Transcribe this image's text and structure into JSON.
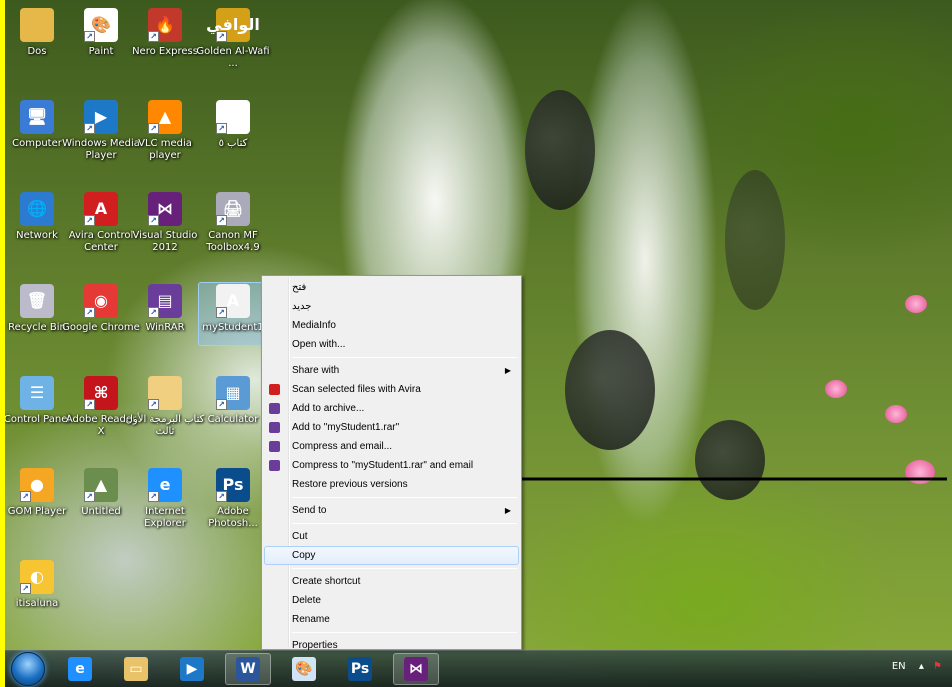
{
  "desktop_icons": [
    {
      "label": "Dos",
      "icon": "folder-user-icon",
      "color": "#e6b84a",
      "glyph": ""
    },
    {
      "label": "Paint",
      "icon": "paint-icon",
      "color": "#ffffff",
      "glyph": "🎨"
    },
    {
      "label": "Nero Express",
      "icon": "nero-icon",
      "color": "#c0392b",
      "glyph": "🔥"
    },
    {
      "label": "Golden Al-Wafi ...",
      "icon": "golden-alwafi-icon",
      "color": "#d4a017",
      "glyph": "الوافي"
    },
    {
      "label": "Computer",
      "icon": "computer-icon",
      "color": "#3a7bd5",
      "glyph": "🖥"
    },
    {
      "label": "Windows Media Player",
      "icon": "media-player-icon",
      "color": "#1e78c8",
      "glyph": "▶"
    },
    {
      "label": "VLC media player",
      "icon": "vlc-icon",
      "color": "#ff8800",
      "glyph": "▲"
    },
    {
      "label": "كتاب ٥",
      "icon": "document-icon",
      "color": "#ffffff",
      "glyph": "W"
    },
    {
      "label": "Network",
      "icon": "network-icon",
      "color": "#2d7bd1",
      "glyph": "🌐"
    },
    {
      "label": "Avira Control Center",
      "icon": "avira-icon",
      "color": "#d11f1f",
      "glyph": "A"
    },
    {
      "label": "Visual Studio 2012",
      "icon": "visual-studio-icon",
      "color": "#68217a",
      "glyph": "⋈"
    },
    {
      "label": "Canon MF Toolbox4.9",
      "icon": "canon-icon",
      "color": "#aab",
      "glyph": "🖨"
    },
    {
      "label": "Recycle Bin",
      "icon": "recycle-bin-icon",
      "color": "#bbc",
      "glyph": "🗑"
    },
    {
      "label": "Google Chrome",
      "icon": "chrome-icon",
      "color": "#e53935",
      "glyph": "◉"
    },
    {
      "label": "WinRAR",
      "icon": "winrar-icon",
      "color": "#6a3d9a",
      "glyph": "▤"
    },
    {
      "label": "myStudent1",
      "icon": "access-file-icon",
      "color": "#f2f2f2",
      "glyph": "A"
    },
    {
      "label": "Control Panel",
      "icon": "control-panel-icon",
      "color": "#6fb3e6",
      "glyph": "☰"
    },
    {
      "label": "Adobe Reader X",
      "icon": "adobe-reader-icon",
      "color": "#c4151c",
      "glyph": "⌘"
    },
    {
      "label": "كتاب البرمجة الأول ثالث",
      "icon": "folder-icon",
      "color": "#f0d080",
      "glyph": ""
    },
    {
      "label": "Calculator",
      "icon": "calculator-icon",
      "color": "#5a9bd5",
      "glyph": "▦"
    },
    {
      "label": "GOM Player",
      "icon": "gom-player-icon",
      "color": "#f5a623",
      "glyph": "●"
    },
    {
      "label": "Untitled",
      "icon": "image-file-icon",
      "color": "#6b8e4e",
      "glyph": "▲"
    },
    {
      "label": "Internet Explorer",
      "icon": "internet-explorer-icon",
      "color": "#1e90ff",
      "glyph": "e"
    },
    {
      "label": "Adobe Photosh...",
      "icon": "photoshop-icon",
      "color": "#0a4c8c",
      "glyph": "Ps"
    },
    {
      "label": "itisaluna",
      "icon": "itisaluna-icon",
      "color": "#f7c531",
      "glyph": "◐"
    }
  ],
  "context_menu": {
    "groups": [
      [
        {
          "label": "فتح",
          "icon": "",
          "rtl": true
        },
        {
          "label": "جديد",
          "icon": "",
          "rtl": true
        },
        {
          "label": "MediaInfo",
          "icon": ""
        },
        {
          "label": "Open with...",
          "icon": ""
        }
      ],
      [
        {
          "label": "Share with",
          "icon": "",
          "submenu": true
        },
        {
          "label": "Scan selected files with Avira",
          "icon": "avira-icon",
          "icon_color": "#d11f1f"
        },
        {
          "label": "Add to archive...",
          "icon": "winrar-icon",
          "icon_color": "#6a3d9a"
        },
        {
          "label": "Add to \"myStudent1.rar\"",
          "icon": "winrar-icon",
          "icon_color": "#6a3d9a"
        },
        {
          "label": "Compress and email...",
          "icon": "winrar-icon",
          "icon_color": "#6a3d9a"
        },
        {
          "label": "Compress to \"myStudent1.rar\" and email",
          "icon": "winrar-icon",
          "icon_color": "#6a3d9a"
        },
        {
          "label": "Restore previous versions",
          "icon": ""
        }
      ],
      [
        {
          "label": "Send to",
          "icon": "",
          "submenu": true
        }
      ],
      [
        {
          "label": "Cut",
          "icon": ""
        },
        {
          "label": "Copy",
          "icon": "",
          "highlighted": true
        }
      ],
      [
        {
          "label": "Create shortcut",
          "icon": ""
        },
        {
          "label": "Delete",
          "icon": ""
        },
        {
          "label": "Rename",
          "icon": ""
        }
      ],
      [
        {
          "label": "Properties",
          "icon": ""
        }
      ]
    ]
  },
  "taskbar": {
    "items": [
      {
        "icon": "internet-explorer-icon",
        "color": "#1e90ff",
        "glyph": "e"
      },
      {
        "icon": "file-explorer-icon",
        "color": "#e8c36a",
        "glyph": "▭"
      },
      {
        "icon": "media-player-icon",
        "color": "#1e78c8",
        "glyph": "▶"
      },
      {
        "icon": "word-icon",
        "color": "#2b579a",
        "glyph": "W",
        "active": true
      },
      {
        "icon": "paint-icon",
        "color": "#d0e4f5",
        "glyph": "🎨"
      },
      {
        "icon": "photoshop-icon",
        "color": "#0a4c8c",
        "glyph": "Ps"
      },
      {
        "icon": "visual-studio-icon",
        "color": "#68217a",
        "glyph": "⋈",
        "active": true
      }
    ],
    "language": "EN"
  }
}
